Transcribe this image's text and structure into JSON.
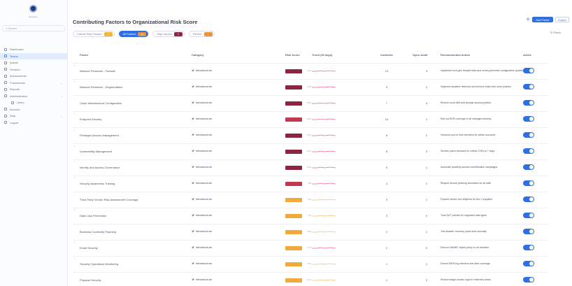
{
  "app": {
    "logo_text": "Company",
    "search_placeholder": "Search"
  },
  "sidebar": {
    "items": [
      {
        "label": "Dashboard",
        "active": false,
        "sub": false,
        "chevron": false
      },
      {
        "label": "Teams",
        "active": true,
        "sub": false,
        "chevron": false
      },
      {
        "label": "Assets",
        "active": false,
        "sub": false,
        "chevron": false
      },
      {
        "label": "Vendors",
        "active": false,
        "sub": false,
        "chevron": false
      },
      {
        "label": "Assessments",
        "active": false,
        "sub": false,
        "chevron": false
      },
      {
        "label": "Frameworks",
        "active": false,
        "sub": false,
        "chevron": true
      },
      {
        "label": "Reports",
        "active": false,
        "sub": false,
        "chevron": false
      },
      {
        "label": "Administration",
        "active": false,
        "sub": false,
        "chevron": true
      },
      {
        "label": "Users",
        "active": false,
        "sub": true,
        "chevron": false
      },
      {
        "label": "Account",
        "active": false,
        "sub": false,
        "chevron": false
      },
      {
        "label": "Help",
        "active": false,
        "sub": false,
        "chevron": true
      },
      {
        "label": "Logout",
        "active": false,
        "sub": false,
        "chevron": false
      }
    ]
  },
  "page": {
    "title": "Contributing Factors to Organizational Risk Score",
    "primary_button": "Add Factor",
    "secondary_button": "Export",
    "filter_label": "Filters"
  },
  "chips": [
    {
      "label": "Critical Risk Factors",
      "count": "3",
      "count_color": "#f5b52e",
      "active": false
    },
    {
      "label": "All Factors",
      "count": "24",
      "count_color": "#e8923a",
      "active": true
    },
    {
      "label": "High Impact",
      "count": "5",
      "count_color": "#8e2540",
      "active": false
    },
    {
      "label": "Recent",
      "count": "7",
      "count_color": "#e8923a",
      "active": false
    }
  ],
  "columns": [
    "Factor",
    "Category",
    "Risk Score",
    "Trend (30 days)",
    "Incidents",
    "Open Audit",
    "Recommended Action",
    "Active"
  ],
  "rows": [
    {
      "factor": "Network Perimeter - Firewall",
      "expandable": true,
      "category": "Infrastructure",
      "score": "9.42",
      "score_color": "#8e2540",
      "trend_color": "#e06a8a",
      "incidents": "12",
      "audit": "3",
      "action": "Implement next-gen firewall rules and review perimeter configuration quarterly.",
      "active": true
    },
    {
      "factor": "Network Perimeter - Segmentation",
      "expandable": true,
      "category": "Infrastructure",
      "score": "9.15",
      "score_color": "#8e2540",
      "trend_color": "#e06a8a",
      "incidents": "9",
      "audit": "2",
      "action": "Segment sensitive networks and enforce strict inter-zone policies.",
      "active": true
    },
    {
      "factor": "Cloud Infrastructure Configuration",
      "expandable": false,
      "category": "Infrastructure",
      "score": "8.97",
      "score_color": "#8e2540",
      "trend_color": "#e06a8a",
      "incidents": "7",
      "audit": "4",
      "action": "Review cloud IAM and storage access policies.",
      "active": true
    },
    {
      "factor": "Endpoint Security",
      "expandable": true,
      "category": "Infrastructure",
      "score": "8.64",
      "score_color": "#c0394f",
      "trend_color": "#e06a8a",
      "incidents": "10",
      "audit": "1",
      "action": "Roll out EDR coverage to all managed devices.",
      "active": true
    },
    {
      "factor": "Privileged Access Management",
      "expandable": true,
      "category": "Infrastructure",
      "score": "8.51",
      "score_color": "#8e2540",
      "trend_color": "#e06a8a",
      "incidents": "6",
      "audit": "2",
      "action": "Introduce just-in-time elevation for admin accounts.",
      "active": true
    },
    {
      "factor": "Vulnerability Management",
      "expandable": true,
      "category": "Infrastructure",
      "score": "8.33",
      "score_color": "#8e2540",
      "trend_color": "#e06a8a",
      "incidents": "8",
      "audit": "3",
      "action": "Shorten patch windows for critical CVEs to 7 days.",
      "active": true
    },
    {
      "factor": "Identity and Access Governance",
      "expandable": true,
      "category": "Infrastructure",
      "score": "8.02",
      "score_color": "#8e2540",
      "trend_color": "#e06a8a",
      "incidents": "5",
      "audit": "1",
      "action": "Automate quarterly access recertification campaigns.",
      "active": true
    },
    {
      "factor": "Security Awareness Training",
      "expandable": true,
      "category": "Infrastructure",
      "score": "7.88",
      "score_color": "#c0394f",
      "trend_color": "#e06a8a",
      "incidents": "4",
      "audit": "2",
      "action": "Require annual phishing simulation for all staff.",
      "active": true
    },
    {
      "factor": "Third-Party Vendor Risk Assessment Coverage",
      "expandable": false,
      "category": "Infrastructure",
      "score": "7.45",
      "score_color": "#f2a93b",
      "trend_color": "#f2c06a",
      "incidents": "3",
      "audit": "1",
      "action": "Expand vendor due diligence for tier-1 suppliers.",
      "active": true
    },
    {
      "factor": "Data Loss Prevention",
      "expandable": true,
      "category": "Infrastructure",
      "score": "7.21",
      "score_color": "#f2a93b",
      "trend_color": "#f2c06a",
      "incidents": "3",
      "audit": "0",
      "action": "Tune DLP policies for regulated data types.",
      "active": true
    },
    {
      "factor": "Business Continuity Planning",
      "expandable": false,
      "category": "Infrastructure",
      "score": "6.98",
      "score_color": "#f2a93b",
      "trend_color": "#f2c06a",
      "incidents": "2",
      "audit": "1",
      "action": "Test disaster recovery plans semi-annually.",
      "active": true
    },
    {
      "factor": "Email Security",
      "expandable": true,
      "category": "Infrastructure",
      "score": "6.74",
      "score_color": "#f2a93b",
      "trend_color": "#e06a8a",
      "incidents": "2",
      "audit": "0",
      "action": "Enforce DMARC reject policy on all domains.",
      "active": true
    },
    {
      "factor": "Security Operations Monitoring",
      "expandable": true,
      "category": "Infrastructure",
      "score": "6.50",
      "score_color": "#f2a93b",
      "trend_color": "#f2c06a",
      "incidents": "1",
      "audit": "1",
      "action": "Extend SIEM log retention and alert coverage.",
      "active": true
    },
    {
      "factor": "Physical Security",
      "expandable": false,
      "category": "Infrastructure",
      "score": "6.12",
      "score_color": "#f2a93b",
      "trend_color": "#f2c06a",
      "incidents": "1",
      "audit": "0",
      "action": "Review badge access logs for restricted areas.",
      "active": true
    }
  ]
}
